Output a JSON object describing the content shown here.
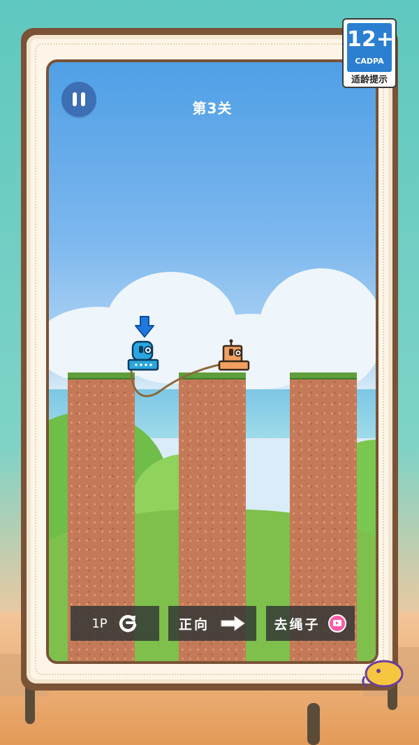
{
  "hud": {
    "level_label": "第3关"
  },
  "toolbar": {
    "moves_label": "1P",
    "direction_label": "正向",
    "remove_rope_label": "去绳子"
  },
  "age_rating": {
    "age": "12+",
    "org": "CADPA",
    "tip": "适龄提示"
  },
  "icons": {
    "pause": "pause-icon",
    "restart": "restart-icon",
    "direction": "arrow-right-icon",
    "video_ad": "video-ad-icon",
    "player_marker": "arrow-down-icon"
  },
  "colors": {
    "pillar": "#c47a58",
    "grass": "#5f9e3a",
    "player_robot": "#2aa7e0",
    "partner_robot": "#f0a060",
    "toolbar_button": "#2f3434",
    "frame": "#7a5236"
  }
}
